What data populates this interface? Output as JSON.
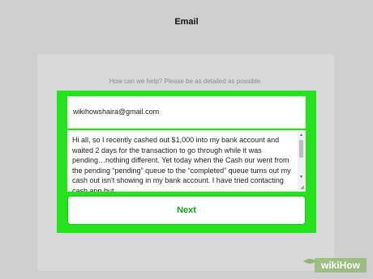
{
  "page": {
    "title": "Email",
    "prompt": "How can we help? Please be as detailed as possible."
  },
  "form": {
    "email_value": "wikihowshaira@gmail.com",
    "message_value": "Hi all, so I recently cashed out $1,000 into my bank account and waited 2 days for the transaction to go through while it was pending…nothing different. Yet today when the Cash our went from the pending “pending” queue to the “completed” queue turns out my cash out isn't showing in my bank account. I have tried contacting cash app but…",
    "next_label": "Next"
  },
  "watermark": {
    "text": "wikiHow"
  },
  "colors": {
    "highlight": "#22e31c",
    "button_text": "#18a515",
    "background": "#cfcfcf"
  },
  "icons": {
    "scroll_up": "triangle-up",
    "scroll_down": "triangle-down"
  }
}
